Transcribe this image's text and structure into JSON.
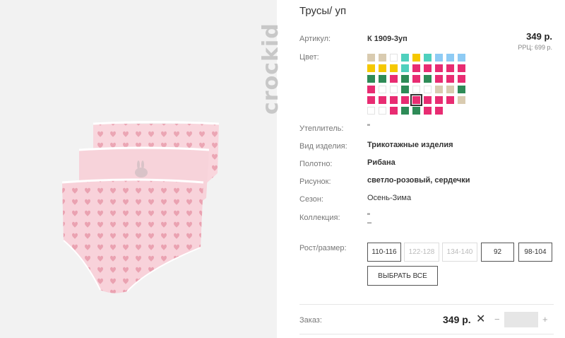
{
  "brand": {
    "logo_text": "crockid"
  },
  "product": {
    "title": "Трусы/ уп",
    "article_label": "Артикул:",
    "article_value": "К 1909-3уп",
    "price": "349 р.",
    "rrc": "РРЦ: 699 р.",
    "color_label": "Цвет:",
    "swatch_rows": [
      [
        "#d9cbb0",
        "#d9cbb0",
        "#ffffff",
        "#4fd0bd",
        "#f5c800",
        "#4fd0bd",
        "#8ecbf4",
        "#8ecbf4",
        "#8ecbf4"
      ],
      [
        "#f5c800",
        "#f5c800",
        "#f5c800",
        "#4fd0bd",
        "#e82c72",
        "#e82c72",
        "#e82c72",
        "#e82c72",
        "#e82c72"
      ],
      [
        "#2e8b57",
        "#2e8b57",
        "#e82c72",
        "#2e8b57",
        "#e82c72",
        "#2e8b57",
        "#e82c72",
        "#e82c72",
        "#e82c72"
      ],
      [
        "#e82c72",
        "#ffffff",
        "#ffffff",
        "#2e8b57",
        "#ffffff",
        "#ffffff",
        "#d9cbb0",
        "#d9cbb0",
        "#2e8b57"
      ],
      [
        "#e82c72",
        "#e82c72",
        "#e82c72",
        "#e82c72",
        "#e82c72",
        "#e82c72",
        "#e82c72",
        "#e82c72",
        "#d9cbb0"
      ],
      [
        "#ffffff",
        "#ffffff",
        "#e82c72",
        "#2e8b57",
        "#2e8b57",
        "#e82c72",
        "#e82c72"
      ]
    ],
    "selected_swatch": "4-4",
    "attributes": [
      {
        "label": "Утеплитель:",
        "value": "\"",
        "bold": false
      },
      {
        "label": "Вид изделия:",
        "value": "Трикотажные изделия",
        "bold": true
      },
      {
        "label": "Полотно:",
        "value": "Рибана",
        "bold": true
      },
      {
        "label": "Рисунок:",
        "value": "светло-розовый, сердечки",
        "bold": true
      },
      {
        "label": "Сезон:",
        "value": "Осень-Зима",
        "bold": false
      },
      {
        "label": "Коллекция:",
        "value": "\"\n–",
        "bold": false
      }
    ],
    "sizes_label": "Рост/размер:",
    "sizes": [
      {
        "label": "110-116",
        "available": true
      },
      {
        "label": "122-128",
        "available": false
      },
      {
        "label": "134-140",
        "available": false
      },
      {
        "label": "92",
        "available": true
      },
      {
        "label": "98-104",
        "available": true
      }
    ],
    "select_all_label": "ВЫБРАТЬ ВСЕ"
  },
  "order": {
    "label": "Заказ:",
    "price": "349 р.",
    "remove_symbol": "✕",
    "minus": "−",
    "plus": "+",
    "quantity": ""
  }
}
